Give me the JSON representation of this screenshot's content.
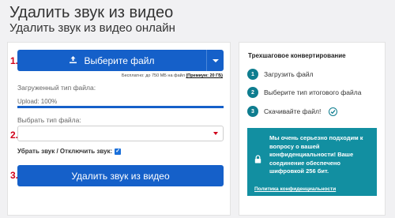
{
  "header": {
    "title": "Удалить звук из видео",
    "subtitle": "Удалить звук из видео онлайн"
  },
  "steps_markers": [
    "1.",
    "2.",
    "3."
  ],
  "upload": {
    "button_label": "Выберите файл",
    "limit_text": "Бесплатно: до 750 МБ на файл",
    "premium_label": "(Премиум: 20 ГБ)",
    "uploaded_type_label": "Загруженный тип файла:",
    "upload_status": "Upload: 100%",
    "progress": 1.0
  },
  "output": {
    "select_label": "Выбрать тип файла:",
    "select_value": ""
  },
  "mute": {
    "label": "Убрать звук / Отключить звук:",
    "checked": true
  },
  "action": {
    "remove_button_label": "Удалить звук из видео"
  },
  "sidebar": {
    "title": "Трехшаговое конвертирование",
    "steps": [
      {
        "num": "1",
        "label": "Загрузить файл"
      },
      {
        "num": "2",
        "label": "Выберите тип итогового файла"
      },
      {
        "num": "3",
        "label": "Скачивайте файл!"
      }
    ],
    "security_text": "Мы очень серьезно подходим к вопросу о вашей конфиденциальности! Ваше соединение обеспечено шифровкой 256 бит.",
    "privacy_link": "Политика конфиденциальности"
  },
  "colors": {
    "primary": "#1560c9",
    "teal": "#128fa1",
    "marker_red": "#d0021b"
  },
  "icons": {
    "upload": "upload-icon",
    "dropdown": "chevron-down-icon",
    "check": "check-circle-icon",
    "lock": "lock-icon"
  }
}
